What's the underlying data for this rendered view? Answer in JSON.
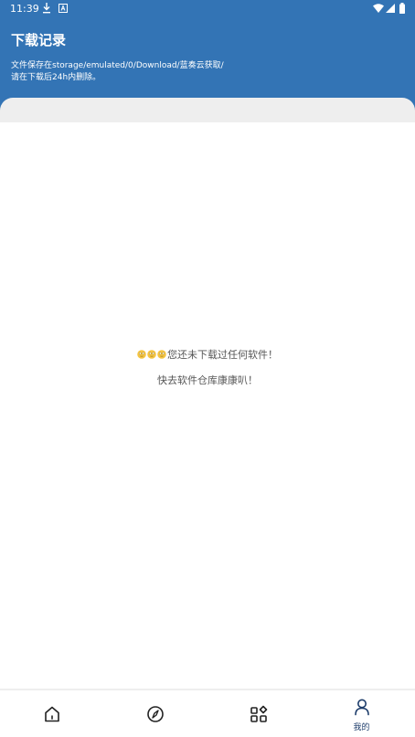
{
  "status_bar": {
    "time": "11:39"
  },
  "header": {
    "title": "下载记录",
    "path_line1": "文件保存在storage/emulated/0/Download/蓝奏云获取/",
    "path_line2": "请在下载后24h内删除。"
  },
  "empty_state": {
    "message": "您还未下载过任何软件！",
    "hint": "快去软件仓库康康叭！"
  },
  "bottom_nav": {
    "items": [
      {
        "icon": "home-icon",
        "label": ""
      },
      {
        "icon": "compass-icon",
        "label": ""
      },
      {
        "icon": "apps-icon",
        "label": ""
      },
      {
        "icon": "person-icon",
        "label": "我的"
      }
    ]
  },
  "colors": {
    "header_bg": "#3374b5",
    "nav_active": "#1d3c6a"
  }
}
